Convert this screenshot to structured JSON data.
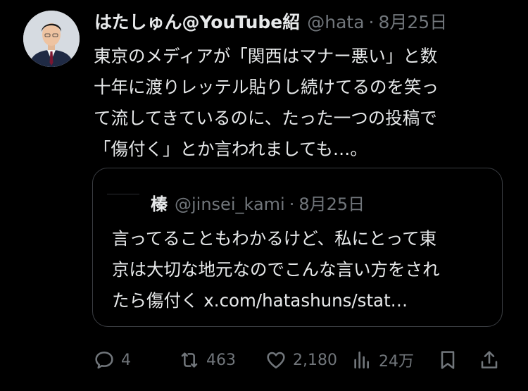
{
  "tweet": {
    "author_name": "はたしゅん@YouTube紹",
    "author_handle": "@hata",
    "separator": "·",
    "date": "8月25日",
    "text": "東京のメディアが「関西はマナー悪い」と数\n十年に渡りレッテル貼りし続けてるのを笑っ\nて流してきているのに、たった一つの投稿で\n「傷付く」とか言われましても…。"
  },
  "quote": {
    "author_name": "榛",
    "author_handle": "@jinsei_kami",
    "separator": "·",
    "date": "8月25日",
    "text": "言ってることもわかるけど、私にとって東\n京は大切な地元なのでこんな言い方をされ\nたら傷付く x.com/hatashuns/stat…"
  },
  "actions": {
    "replies": "4",
    "reposts": "463",
    "likes": "2,180",
    "views": "24万"
  },
  "icons": [
    "reply-icon",
    "repost-icon",
    "like-icon",
    "views-icon",
    "bookmark-icon",
    "share-icon"
  ]
}
